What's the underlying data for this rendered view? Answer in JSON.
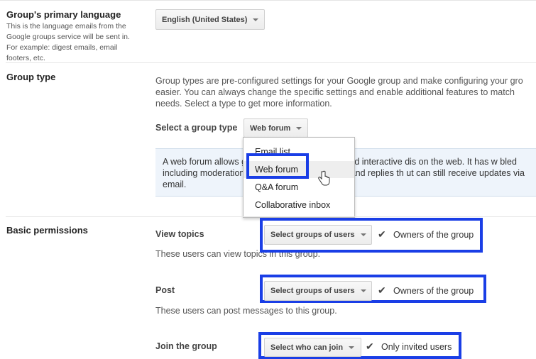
{
  "language": {
    "title": "Group's primary language",
    "help": "This is the language emails from the Google groups service will be sent in. For example: digest emails, email footers, etc.",
    "selected": "English (United States)"
  },
  "group_type": {
    "title": "Group type",
    "description": "Group types are pre-configured settings for your Google group and make configuring your gro easier. You can always change the specific settings and enable additional features to match needs. Select a type to get more information.",
    "select_label": "Select a group type",
    "selected": "Web forum",
    "info_text": "A web forum allows group and have engaging and interactive dis on the web. It has w bled including moderation tools. Group memb topics and replies th ut can still receive updates via email.",
    "menu_items": [
      "Email list",
      "Web forum",
      "Q&A forum",
      "Collaborative inbox"
    ]
  },
  "basic_permissions": {
    "title": "Basic permissions",
    "view_topics": {
      "label": "View topics",
      "button": "Select groups of users",
      "option": "Owners of the group",
      "help": "These users can view topics in this group."
    },
    "post": {
      "label": "Post",
      "button": "Select groups of users",
      "option": "Owners of the group",
      "help": "These users can post messages to this group."
    },
    "join": {
      "label": "Join the group",
      "button": "Select who can join",
      "option": "Only invited users"
    }
  },
  "icons": {
    "caret": "chevron-down-icon",
    "check": "checkmark-icon",
    "cursor": "hand-pointer-icon"
  },
  "colors": {
    "highlight_border": "#1a3ee6",
    "info_bg": "#eef4fb"
  }
}
